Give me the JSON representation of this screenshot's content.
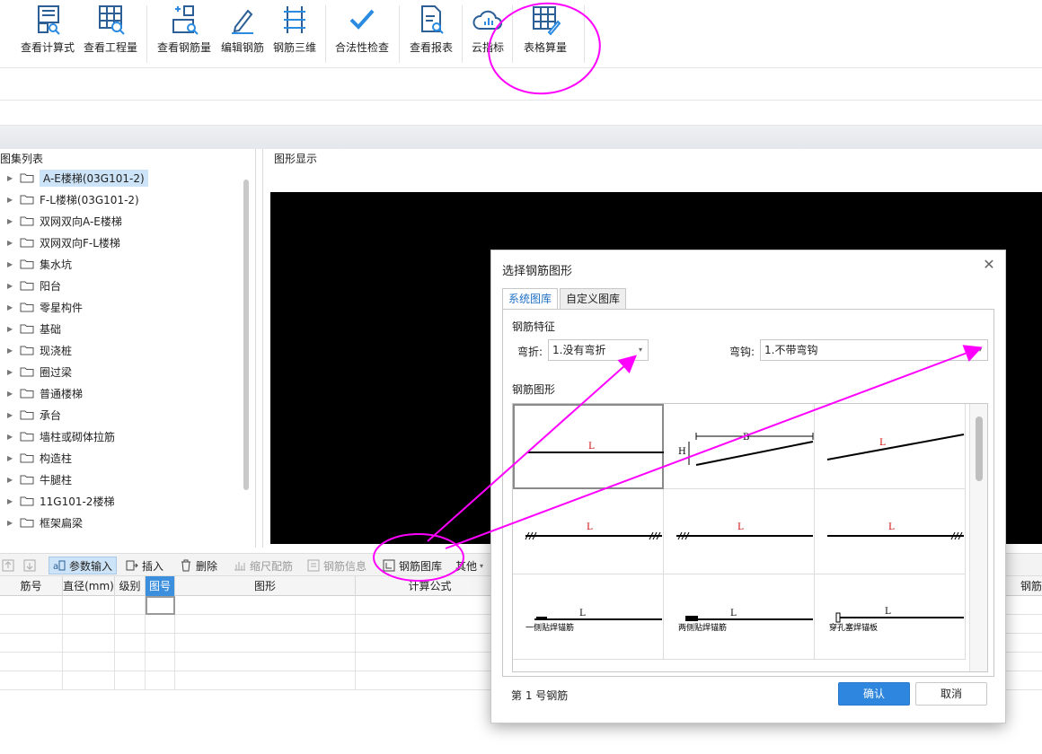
{
  "ribbon": {
    "buttons": [
      {
        "label": "查看计算式",
        "icon": "view-formula-icon"
      },
      {
        "label": "查看工程量",
        "icon": "view-quantity-icon"
      },
      {
        "label": "查看钢筋量",
        "icon": "view-rebar-icon"
      },
      {
        "label": "编辑钢筋",
        "icon": "edit-rebar-icon"
      },
      {
        "label": "钢筋三维",
        "icon": "rebar-3d-icon"
      },
      {
        "label": "合法性检查",
        "icon": "check-icon"
      },
      {
        "label": "查看报表",
        "icon": "report-icon"
      },
      {
        "label": "云指标",
        "icon": "cloud-index-icon"
      },
      {
        "label": "表格算量",
        "icon": "table-calc-icon"
      }
    ]
  },
  "left_panel": {
    "title": "图集列表",
    "items": [
      "A-E楼梯(03G101-2)",
      "F-L楼梯(03G101-2)",
      "双网双向A-E楼梯",
      "双网双向F-L楼梯",
      "集水坑",
      "阳台",
      "零星构件",
      "基础",
      "现浇桩",
      "圈过梁",
      "普通楼梯",
      "承台",
      "墙柱或砌体拉筋",
      "构造柱",
      "牛腿柱",
      "11G101-2楼梯",
      "框架扁梁"
    ],
    "selected_index": 0
  },
  "graphics_panel": {
    "title": "图形显示"
  },
  "bottom_toolbar": {
    "items": [
      {
        "label": "参数输入",
        "state": "active"
      },
      {
        "label": "插入",
        "state": "normal"
      },
      {
        "label": "删除",
        "state": "normal"
      },
      {
        "label": "缩尺配筋",
        "state": "disabled"
      },
      {
        "label": "钢筋信息",
        "state": "disabled"
      },
      {
        "label": "钢筋图库",
        "state": "normal"
      },
      {
        "label": "其他",
        "state": "normal"
      }
    ]
  },
  "grid": {
    "headers": [
      "筋号",
      "直径(mm)",
      "级别",
      "图号",
      "图形",
      "计算公式",
      "钢筋"
    ],
    "highlighted_header": "图号",
    "row_count": 5
  },
  "dialog": {
    "title": "选择钢筋图形",
    "tabs": [
      "系统图库",
      "自定义图库"
    ],
    "active_tab": 0,
    "feature_section": "钢筋特征",
    "bend_label": "弯折:",
    "bend_value": "1.没有弯折",
    "hook_label": "弯钩:",
    "hook_value": "1.不带弯钩",
    "shape_section": "钢筋图形",
    "shapes": [
      {
        "id": 1,
        "labels": [
          "L"
        ]
      },
      {
        "id": 2,
        "labels": [
          "B",
          "H"
        ]
      },
      {
        "id": 3,
        "labels": [
          "L"
        ]
      },
      {
        "id": 4,
        "labels": [
          "L"
        ]
      },
      {
        "id": 5,
        "labels": [
          "L"
        ]
      },
      {
        "id": 6,
        "labels": [
          "L"
        ]
      },
      {
        "id": 7,
        "labels": [
          "L",
          "一侧贴焊锚筋"
        ]
      },
      {
        "id": 8,
        "labels": [
          "L",
          "两侧贴焊锚筋"
        ]
      },
      {
        "id": 9,
        "labels": [
          "L",
          "穿孔塞焊锚板"
        ]
      }
    ],
    "selected_shape": 1,
    "status": "第 1 号钢筋",
    "ok_label": "确认",
    "cancel_label": "取消"
  },
  "annotation_color": "#ff00ff"
}
